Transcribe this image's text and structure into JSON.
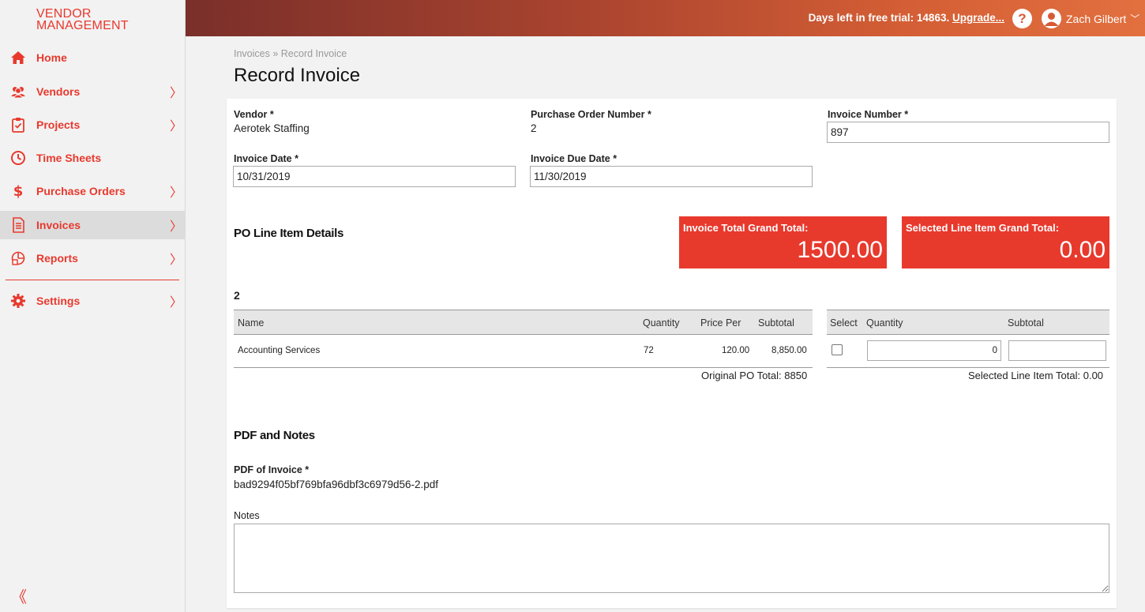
{
  "app": {
    "logo_line1": "VENDOR",
    "logo_line2": "MANAGEMENT",
    "accent_color": "#e8392d"
  },
  "topbar": {
    "trial_text": "Days left in free trial: 14863.",
    "upgrade_label": "Upgrade...",
    "help_label": "?",
    "user_name": "Zach Gilbert",
    "user_chevron": "﹀"
  },
  "sidebar": {
    "items": [
      {
        "label": "Home",
        "icon": "home-icon",
        "chevron": ""
      },
      {
        "label": "Vendors",
        "icon": "users-icon",
        "chevron": "〉"
      },
      {
        "label": "Projects",
        "icon": "clipboard-icon",
        "chevron": "〉"
      },
      {
        "label": "Time Sheets",
        "icon": "clock-icon",
        "chevron": ""
      },
      {
        "label": "Purchase Orders",
        "icon": "dollar-icon",
        "chevron": "〉"
      },
      {
        "label": "Invoices",
        "icon": "invoice-icon",
        "chevron": "〉",
        "active": true
      },
      {
        "label": "Reports",
        "icon": "reports-icon",
        "chevron": "〉"
      },
      {
        "label": "Settings",
        "icon": "gear-icon",
        "chevron": "〉"
      }
    ],
    "collapse_label": "《"
  },
  "breadcrumb": {
    "parent": "Invoices",
    "separator": "»",
    "current": "Record Invoice"
  },
  "page": {
    "title": "Record Invoice"
  },
  "form": {
    "vendor_label": "Vendor *",
    "vendor_value": "Aerotek Staffing",
    "po_number_label": "Purchase Order Number *",
    "po_number_value": "2",
    "invoice_number_label": "Invoice Number *",
    "invoice_number_value": "897",
    "invoice_date_label": "Invoice Date *",
    "invoice_date_value": "10/31/2019",
    "invoice_due_label": "Invoice Due Date *",
    "invoice_due_value": "11/30/2019"
  },
  "line_items": {
    "section_title": "PO Line Item Details",
    "invoice_total_label": "Invoice Total Grand Total:",
    "invoice_total_value": "1500.00",
    "selected_total_label": "Selected Line Item Grand Total:",
    "selected_total_value": "0.00",
    "po_number": "2",
    "left_columns": {
      "name": "Name",
      "quantity": "Quantity",
      "price_per": "Price Per",
      "subtotal": "Subtotal"
    },
    "right_columns": {
      "select": "Select",
      "quantity": "Quantity",
      "subtotal": "Subtotal"
    },
    "rows": [
      {
        "name": "Accounting Services",
        "quantity": "72",
        "price_per": "120.00",
        "subtotal": "8,850.00",
        "selected": false,
        "sel_quantity": "0",
        "sel_subtotal": ""
      }
    ],
    "original_po_total": "Original PO Total: 8850",
    "selected_line_total": "Selected Line Item Total: 0.00"
  },
  "pdf_notes": {
    "section_title": "PDF and Notes",
    "pdf_label": "PDF of Invoice *",
    "pdf_filename": "bad9294f05bf769bfa96dbf3c6979d56-2.pdf",
    "notes_label": "Notes",
    "notes_value": ""
  }
}
